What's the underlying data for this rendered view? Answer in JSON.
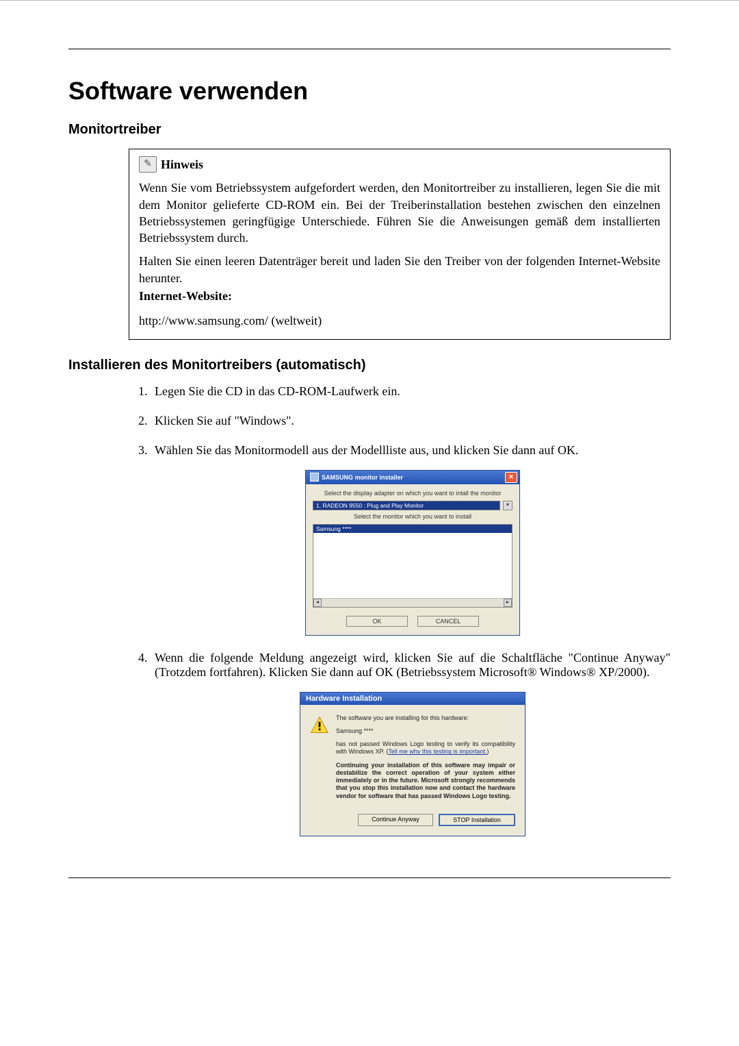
{
  "heading": "Software verwenden",
  "section1": "Monitortreiber",
  "note": {
    "title": "Hinweis",
    "p1": "Wenn Sie vom Betriebssystem aufgefordert werden, den Monitortreiber zu installieren, legen Sie die mit dem Monitor gelieferte CD-ROM ein. Bei der Treiberinstallation bestehen zwischen den einzelnen Betriebssystemen geringfügige Unterschiede. Führen Sie die Anweisungen gemäß dem installierten Betriebssystem durch.",
    "p2": "Halten Sie einen leeren Datenträger bereit und laden Sie den Treiber von der folgenden Internet-Website herunter.",
    "label": "Internet-Website:",
    "url": "http://www.samsung.com/ (weltweit)"
  },
  "section2": "Installieren des Monitortreibers (automatisch)",
  "steps": {
    "s1": "Legen Sie die CD in das CD-ROM-Laufwerk ein.",
    "s2": "Klicken Sie auf \"Windows\".",
    "s3": "Wählen Sie das Monitormodell aus der Modellliste aus, und klicken Sie dann auf OK.",
    "s4": "Wenn die folgende Meldung angezeigt wird, klicken Sie auf die Schaltfläche \"Continue Anyway\" (Trotzdem fortfahren). Klicken Sie dann auf OK (Betriebssystem Microsoft® Windows® XP/2000)."
  },
  "samsung": {
    "title": "SAMSUNG monitor installer",
    "instr1": "Select the display adapter on which you want to intall the monitor",
    "adapter": "1. RADEON 9550 : Plug and Play Monitor",
    "instr2": "Select the monitor which you want to install",
    "listItem": "Samsung ****",
    "ok": "OK",
    "cancel": "CANCEL"
  },
  "hw": {
    "title": "Hardware Installation",
    "line1": "The software you are installing for this hardware:",
    "name": "Samsung ****",
    "line2a": "has not passed Windows Logo testing to verify its compatibility with Windows XP. (",
    "tell": "Tell me why this testing is important.",
    "line2b": ")",
    "bold": "Continuing your installation of this software may impair or destabilize the correct operation of your system either immediately or in the future. Microsoft strongly recommends that you stop this installation now and contact the hardware vendor for software that has passed Windows Logo testing.",
    "btnContinue": "Continue Anyway",
    "btnStop": "STOP Installation"
  }
}
